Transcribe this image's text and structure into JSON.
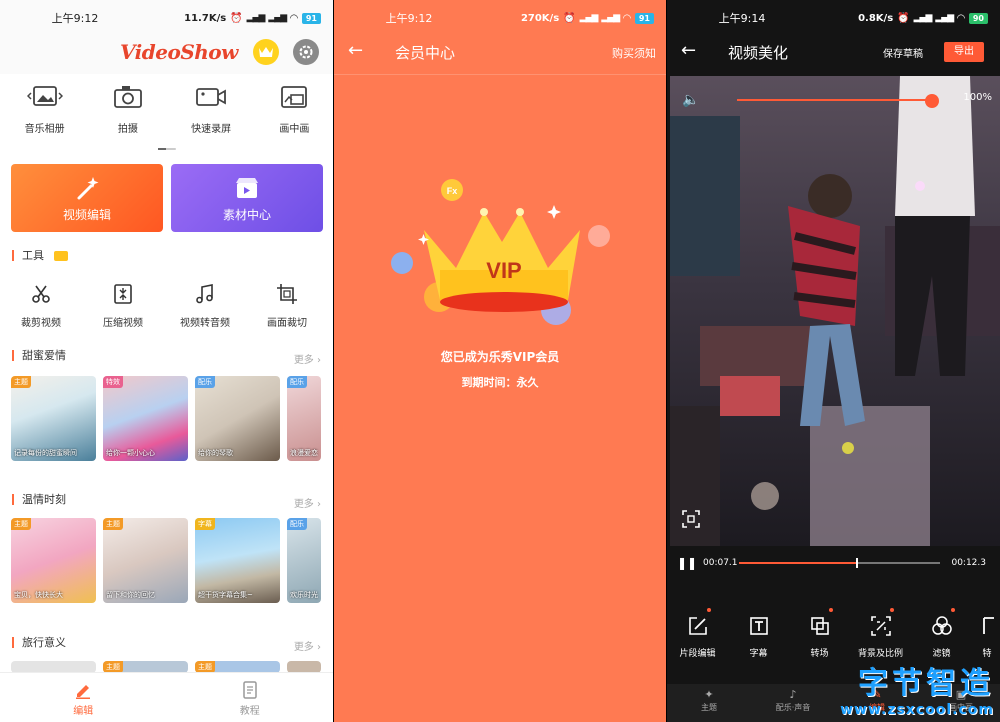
{
  "panel1": {
    "status": {
      "time": "上午9:12",
      "speed": "11.7K/s",
      "battery": "91"
    },
    "logo": "VideoShow",
    "top_icons": [
      {
        "label": "音乐相册",
        "icon": "photo-album-icon"
      },
      {
        "label": "拍摄",
        "icon": "camera-icon"
      },
      {
        "label": "快速录屏",
        "icon": "screen-record-icon"
      },
      {
        "label": "画中画",
        "icon": "picture-in-picture-icon"
      }
    ],
    "big_buttons": {
      "edit": "视频编辑",
      "material": "素材中心"
    },
    "tools_title": "工具",
    "tools": [
      {
        "label": "裁剪视频",
        "icon": "scissors-icon"
      },
      {
        "label": "压缩视频",
        "icon": "compress-icon"
      },
      {
        "label": "视频转音频",
        "icon": "music-note-icon"
      },
      {
        "label": "画面裁切",
        "icon": "crop-icon"
      }
    ],
    "more": "更多",
    "sections": [
      {
        "title": "甜蜜爱情",
        "items": [
          {
            "tag": "主题",
            "caption": "记录每份的甜蜜瞬间"
          },
          {
            "tag": "特效",
            "caption": "给你一颗小心心"
          },
          {
            "tag": "配乐",
            "caption": "给你的琴歌"
          },
          {
            "tag": "配乐",
            "caption": "浪漫爱恋"
          }
        ]
      },
      {
        "title": "温情时刻",
        "items": [
          {
            "tag": "主题",
            "caption": "宝贝，快快长大"
          },
          {
            "tag": "主题",
            "caption": "留下和你的回忆"
          },
          {
            "tag": "字幕",
            "caption": "超干货字幕合集~"
          },
          {
            "tag": "配乐",
            "caption": "欢乐时光"
          }
        ]
      },
      {
        "title": "旅行意义",
        "items": [
          {
            "tag": "",
            "caption": ""
          },
          {
            "tag": "主题",
            "caption": ""
          },
          {
            "tag": "主题",
            "caption": ""
          },
          {
            "tag": "",
            "caption": ""
          }
        ]
      }
    ],
    "bottom_tabs": [
      {
        "label": "编辑",
        "active": true
      },
      {
        "label": "教程",
        "active": false
      }
    ],
    "colors": {
      "accent": "#ff6a3d",
      "edit_btn": "#ff5722",
      "material_btn": "#6e4fe6"
    }
  },
  "panel2": {
    "status": {
      "time": "上午9:12",
      "speed": "270K/s",
      "battery": "91"
    },
    "title": "会员中心",
    "notice": "购买须知",
    "vip_badge": "VIP",
    "fx_badge": "Fx",
    "message": "您已成为乐秀VIP会员",
    "expiry": "到期时间：永久",
    "colors": {
      "background": "#ff7a52"
    }
  },
  "panel3": {
    "status": {
      "time": "上午9:14",
      "speed": "0.8K/s",
      "battery": "90"
    },
    "title": "视频美化",
    "save_draft": "保存草稿",
    "export": "导出",
    "volume": {
      "value_label": "100%",
      "level": 1.0
    },
    "playback": {
      "current": "00:07.1",
      "total": "00:12.3",
      "progress": 0.58
    },
    "edit_tools": [
      {
        "label": "片段编辑",
        "icon": "edit-icon",
        "dot": true
      },
      {
        "label": "字幕",
        "icon": "text-icon",
        "dot": false
      },
      {
        "label": "转场",
        "icon": "transition-icon",
        "dot": true
      },
      {
        "label": "背景及比例",
        "icon": "ratio-icon",
        "dot": true
      },
      {
        "label": "滤镜",
        "icon": "filter-icon",
        "dot": true
      },
      {
        "label": "特",
        "icon": "effects-icon",
        "dot": false
      }
    ],
    "bottom_tabs": [
      {
        "label": "主题"
      },
      {
        "label": "配乐·声音"
      },
      {
        "label": "编辑"
      },
      {
        "label": "画中画"
      }
    ],
    "colors": {
      "accent": "#ff5a36"
    }
  },
  "watermark": {
    "main": "字节智造",
    "sub": "www.zsxcool.com"
  }
}
